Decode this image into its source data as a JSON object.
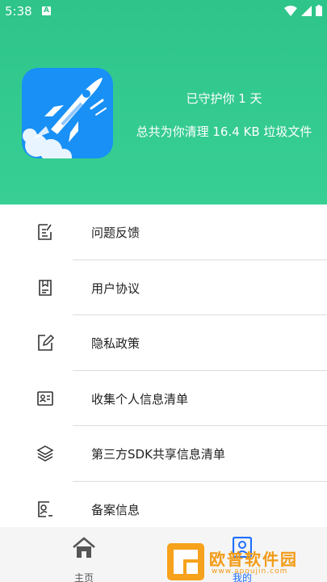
{
  "status_bar": {
    "time": "5:38",
    "notification_glyph": "A"
  },
  "header": {
    "protect_text": "已守护你 1 天",
    "cleaned_text": "总共为你清理 16.4 KB 垃圾文件",
    "logo_icon": "rocket-icon"
  },
  "menu": [
    {
      "label": "问题反馈",
      "icon": "feedback-icon"
    },
    {
      "label": "用户协议",
      "icon": "agreement-icon"
    },
    {
      "label": "隐私政策",
      "icon": "privacy-icon"
    },
    {
      "label": "收集个人信息清单",
      "icon": "id-card-icon"
    },
    {
      "label": "第三方SDK共享信息清单",
      "icon": "layers-icon"
    },
    {
      "label": "备案信息",
      "icon": "user-doc-icon"
    }
  ],
  "bottom_nav": {
    "home_label": "主页",
    "mine_label": "我的"
  },
  "watermark": {
    "text": "欧普软件园",
    "url": "www.apoujin.com"
  },
  "colors": {
    "header_green": "#2ec48a",
    "logo_blue": "#1890f6",
    "active_blue": "#1e6fff"
  }
}
